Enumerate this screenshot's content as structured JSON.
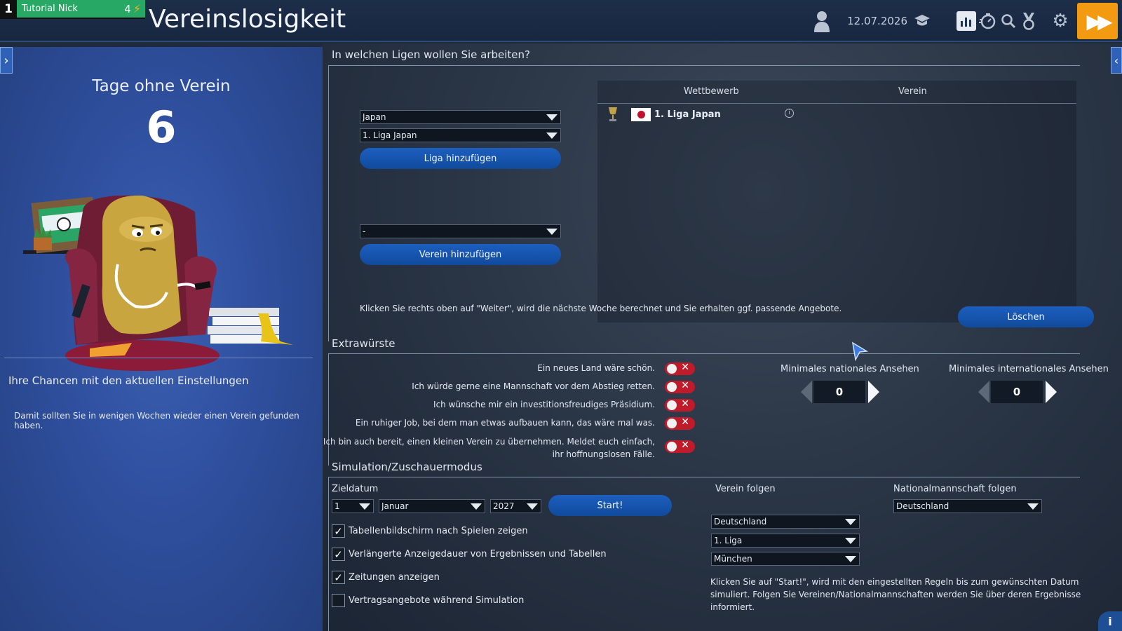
{
  "profile": {
    "level": "1",
    "name": "Tutorial Nick",
    "points": "4"
  },
  "header": {
    "title": "Vereinslosigkeit",
    "date": "12.07.2026"
  },
  "icons": {
    "user": "user-icon",
    "graduation": "graduation-cap-icon",
    "stats": "bar-chart-icon",
    "stopwatch": "stopwatch-icon",
    "search": "search-icon",
    "medal": "medal-icon",
    "settings": "gear-icon",
    "forward": "fast-forward-icon"
  },
  "left": {
    "days_heading": "Tage ohne Verein",
    "days_count": "6",
    "chances_heading": "Ihre Chancen mit den aktuellen Einstellungen",
    "chances_text": "Damit sollten Sie in wenigen Wochen wieder einen Verein gefunden haben."
  },
  "leagues": {
    "title": "In welchen Ligen wollen Sie arbeiten?",
    "country_select": "Japan",
    "league_select": "1. Liga Japan",
    "add_league_label": "Liga hinzufügen",
    "club_select": "-",
    "add_club_label": "Verein hinzufügen",
    "table_header_competition": "Wettbewerb",
    "table_header_club": "Verein",
    "rows": [
      {
        "competition": "1. Liga Japan"
      }
    ],
    "hint": "Klicken Sie rechts oben auf \"Weiter\", wird die nächste Woche berechnet und Sie erhalten ggf. passende Angebote.",
    "delete_label": "Löschen"
  },
  "extras": {
    "title": "Extrawürste",
    "wishes": [
      {
        "label": "Ein neues Land wäre schön."
      },
      {
        "label": "Ich würde gerne eine Mannschaft vor dem Abstieg retten."
      },
      {
        "label": "Ich wünsche mir ein investitionsfreudiges Präsidium."
      },
      {
        "label": "Ein ruhiger Job, bei dem man etwas aufbauen kann, das wäre mal was."
      },
      {
        "label_line1": "Ich bin auch bereit, einen kleinen Verein zu übernehmen. Meldet euch einfach,",
        "label_line2": "ihr hoffnungslosen Fälle."
      }
    ],
    "national_label": "Minimales nationales Ansehen",
    "national_value": "0",
    "international_label": "Minimales internationales Ansehen",
    "international_value": "0"
  },
  "simulation": {
    "title": "Simulation/Zuschauermodus",
    "target_label": "Zieldatum",
    "day": "1",
    "month": "Januar",
    "year": "2027",
    "start_label": "Start!",
    "follow_club_label": "Verein folgen",
    "follow_club_country": "Deutschland",
    "follow_club_league": "1. Liga",
    "follow_club_club": "München",
    "follow_national_label": "Nationalmannschaft folgen",
    "follow_national_country": "Deutschland",
    "options": [
      {
        "label": "Tabellenbildschirm nach Spielen zeigen",
        "checked": true
      },
      {
        "label": "Verlängerte Anzeigedauer von Ergebnissen und Tabellen",
        "checked": true
      },
      {
        "label": "Zeitungen anzeigen",
        "checked": true
      },
      {
        "label": "Vertragsangebote während Simulation",
        "checked": false
      }
    ],
    "info_line1": "Klicken Sie auf \"Start!\", wird mit den eingestellten Regeln bis zum gewünschten Datum",
    "info_line2": "simuliert. Folgen Sie Vereinen/Nationalmannschaften werden Sie über deren Ergebnisse",
    "info_line3": "informiert."
  },
  "colors": {
    "accent_orange": "#f29a12",
    "toggle_red": "#c01b2a",
    "button_blue": "#1d5fbf",
    "profile_green": "#27a865"
  }
}
